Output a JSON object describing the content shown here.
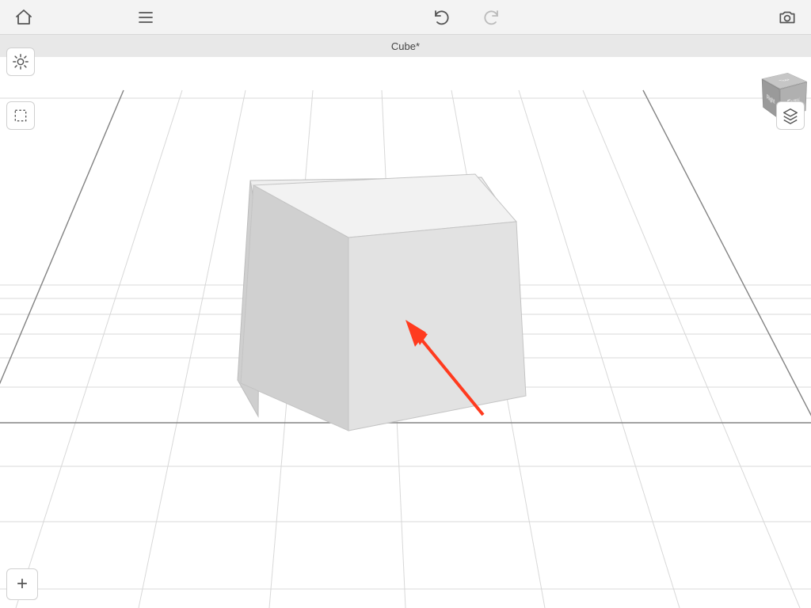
{
  "document": {
    "title": "Cube*"
  },
  "toolbar": {
    "home_label": "Home",
    "menu_label": "Menu",
    "undo_label": "Undo",
    "redo_label": "Redo",
    "camera_label": "Camera"
  },
  "floating": {
    "sun_label": "Environment",
    "select_label": "Selection",
    "layers_label": "Layers",
    "add_label": "+"
  },
  "view_cube": {
    "top": "Top",
    "front": "Front",
    "right": "Right"
  },
  "scene": {
    "object": "Cube"
  },
  "annotation": {
    "arrow_color": "#ff3b1f"
  }
}
